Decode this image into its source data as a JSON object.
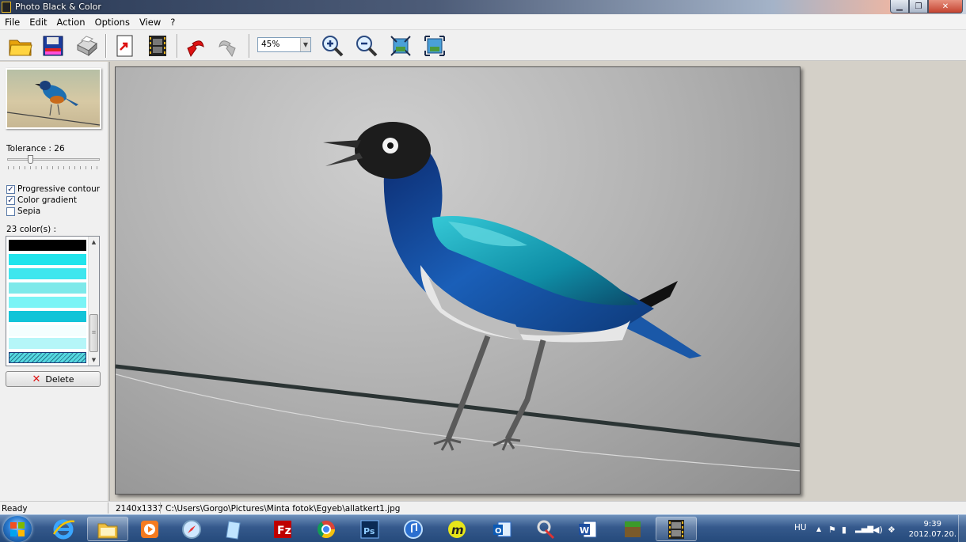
{
  "window": {
    "title": "Photo Black & Color"
  },
  "menu": [
    "File",
    "Edit",
    "Action",
    "Options",
    "View",
    "?"
  ],
  "toolbar": {
    "zoom_value": "45%",
    "buttons": [
      "open-folder",
      "save",
      "print",
      "export-page",
      "film",
      "undo",
      "redo",
      "zoom-in",
      "zoom-out",
      "fit-window",
      "actual-size"
    ]
  },
  "left_panel": {
    "tolerance_label": "Tolerance : 26",
    "tolerance_value": 26,
    "checkboxes": [
      {
        "label": "Progressive contour",
        "checked": true
      },
      {
        "label": "Color gradient",
        "checked": true
      },
      {
        "label": "Sepia",
        "checked": false
      }
    ],
    "colors_label": "23 color(s) :",
    "color_swatches": [
      "#000000",
      "#22e4ec",
      "#3ee6ee",
      "#7ee9ea",
      "#7af4f6",
      "#11c4d8",
      "#f4fefe",
      "#b5f6f8",
      "#55d7df"
    ],
    "delete_label": "Delete"
  },
  "status": {
    "ready": "Ready",
    "dimensions": "2140x1337",
    "path": "C:\\Users\\Gorgo\\Pictures\\Minta fotok\\Egyeb\\allatkert1.jpg"
  },
  "taskbar": {
    "apps": [
      "internet-explorer",
      "file-explorer",
      "media-player",
      "safari",
      "clipboard",
      "filezilla",
      "chrome",
      "photoshop",
      "itunes",
      "messenger",
      "outlook",
      "snipping",
      "word",
      "minecraft",
      "photo-black-color"
    ],
    "tray_language": "HU",
    "time": "9:39",
    "date": "2012.07.20."
  }
}
